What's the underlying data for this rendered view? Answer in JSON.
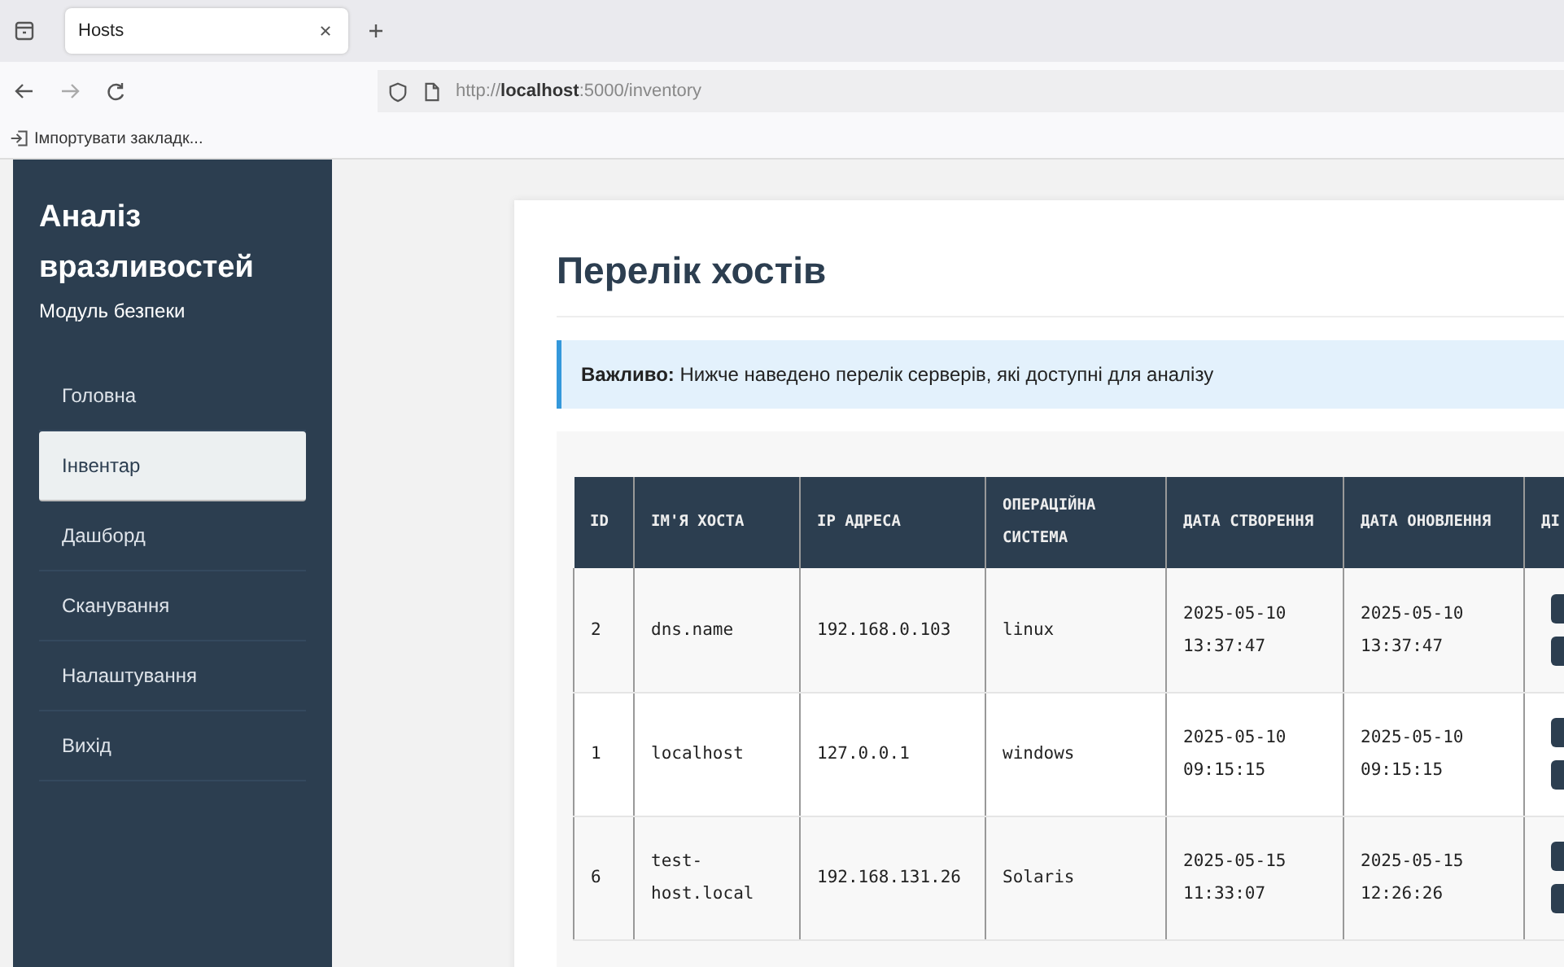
{
  "browser": {
    "tab_title": "Hosts",
    "url_prefix": "http://",
    "url_host": "localhost",
    "url_rest": ":5000/inventory",
    "bookmark": "Імпортувати закладк..."
  },
  "sidebar": {
    "title": "Аналіз вразливостей",
    "subtitle": "Модуль безпеки",
    "items": [
      {
        "label": "Головна",
        "selected": false
      },
      {
        "label": "Інвентар",
        "selected": true
      },
      {
        "label": "Дашборд",
        "selected": false
      },
      {
        "label": "Сканування",
        "selected": false
      },
      {
        "label": "Налаштування",
        "selected": false
      },
      {
        "label": "Вихід",
        "selected": false
      }
    ]
  },
  "page": {
    "title": "Перелік хостів",
    "alert": "**Важливо:** Нижче наведено перелік серверів, які доступні для аналізу"
  },
  "table": {
    "columns": [
      "ID",
      "ІМ'Я ХОСТА",
      "IP АДРЕСА",
      "ОПЕРАЦІЙНА СИСТЕМА",
      "ДАТА СТВОРЕННЯ",
      "ДАТА ОНОВЛЕННЯ",
      "ДІ"
    ],
    "rows": [
      [
        "2",
        "dns.name",
        "192.168.0.103",
        "linux",
        "2025-05-10 13:37:47",
        "2025-05-10 13:37:47"
      ],
      [
        "1",
        "localhost",
        "127.0.0.1",
        "windows",
        "2025-05-10 09:15:15",
        "2025-05-10 09:15:15"
      ],
      [
        "6",
        "test-host.local",
        "192.168.131.26",
        "Solaris",
        "2025-05-15 11:33:07",
        "2025-05-15 12:26:26"
      ]
    ]
  }
}
